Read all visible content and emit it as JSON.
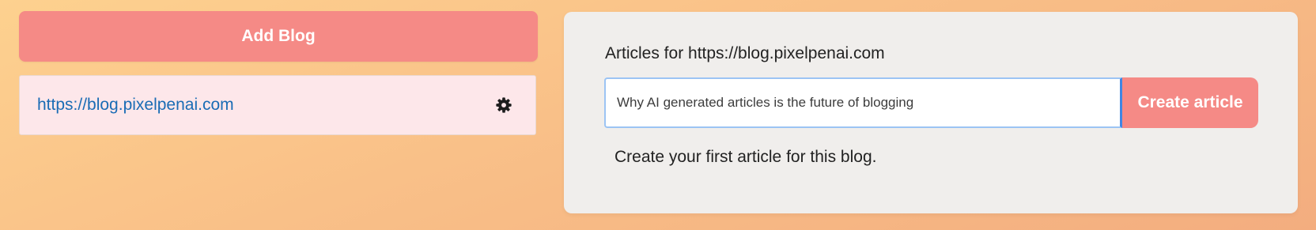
{
  "left_panel": {
    "add_blog_label": "Add Blog",
    "blogs": [
      {
        "url": "https://blog.pixelpenai.com",
        "settings_icon": "gear-icon"
      }
    ]
  },
  "articles_panel": {
    "title": "Articles for https://blog.pixelpenai.com",
    "input_value": "Why AI generated articles is the future of blogging",
    "create_label": "Create article",
    "empty_message": "Create your first article for this blog."
  },
  "colors": {
    "accent": "#f58a86",
    "link": "#1a6cb5",
    "blog_item_bg": "#fde7ea",
    "card_bg": "#f0eeec",
    "input_focus_border": "#3f86e3"
  }
}
